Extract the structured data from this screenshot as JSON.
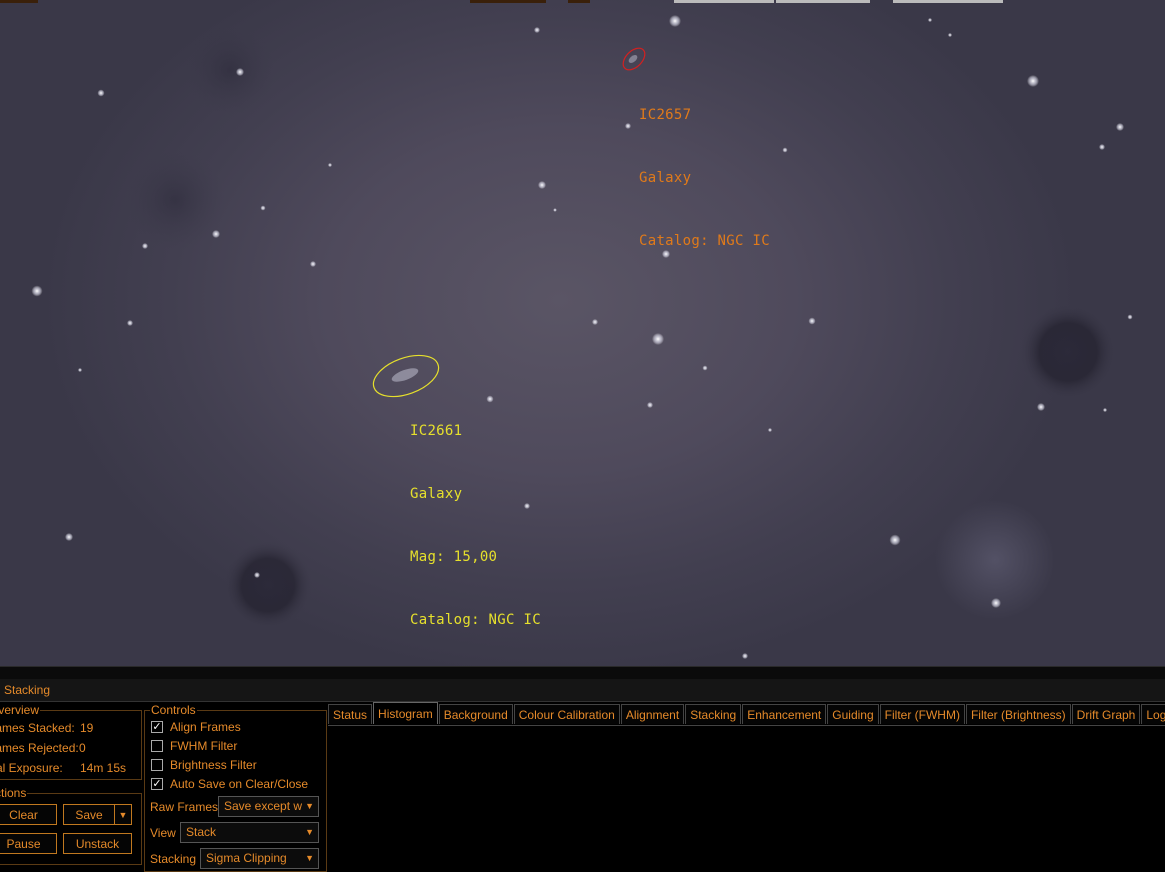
{
  "sky": {
    "annotations": [
      {
        "id": "ic2657",
        "lines": [
          "IC2657",
          "Galaxy",
          "Catalog: NGC IC"
        ],
        "color": "#e07a1a"
      },
      {
        "id": "ic2661",
        "lines": [
          "IC2661",
          "Galaxy",
          "Mag: 15,00",
          "Catalog: NGC IC"
        ],
        "color": "#e6e02c"
      }
    ]
  },
  "panel": {
    "title": "Stacking",
    "overview": {
      "label": "Overview",
      "rows": [
        {
          "label": "Frames Stacked:",
          "value": "19"
        },
        {
          "label": "Frames Rejected:",
          "value": "0"
        },
        {
          "label": "Total Exposure:",
          "value": "14m 15s"
        }
      ]
    },
    "actions": {
      "label": "Actions",
      "clear": "Clear",
      "save": "Save",
      "pause": "Pause",
      "unstack": "Unstack"
    },
    "controls": {
      "label": "Controls",
      "checks": [
        {
          "label": "Align Frames",
          "checked": true
        },
        {
          "label": "FWHM Filter",
          "checked": false
        },
        {
          "label": "Brightness Filter",
          "checked": false
        },
        {
          "label": "Auto Save on Clear/Close",
          "checked": true
        }
      ],
      "raw_frames_label": "Raw Frames",
      "raw_frames_value": "Save except w",
      "view_label": "View",
      "view_value": "Stack",
      "stacking_label": "Stacking",
      "stacking_value": "Sigma Clipping"
    },
    "tabs": [
      "Status",
      "Histogram",
      "Background",
      "Colour Calibration",
      "Alignment",
      "Stacking",
      "Enhancement",
      "Guiding",
      "Filter (FWHM)",
      "Filter (Brightness)",
      "Drift Graph",
      "Log"
    ],
    "active_tab": "Histogram"
  },
  "colors": {
    "accent": "#e58a2a",
    "annotation_orange": "#e07a1a",
    "annotation_yellow": "#e6e02c"
  },
  "icons": [
    "checkmark-icon",
    "chevron-down-icon"
  ]
}
